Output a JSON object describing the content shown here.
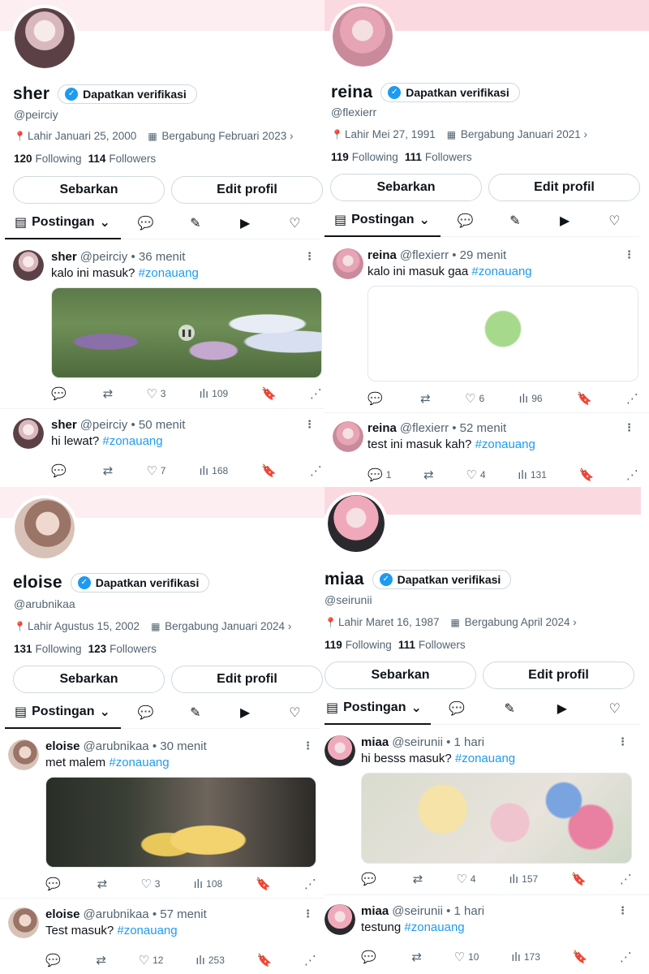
{
  "colors": {
    "accent": "#1d9bf0",
    "banner_pink": "#fbd9e0",
    "banner_light": "#fdeef2"
  },
  "icons": {
    "location": "📍",
    "calendar": "▦",
    "chevron": "›",
    "posts_tab": "▤",
    "chevron_down": "⌄",
    "reply": "💬",
    "highlights": "✎",
    "media": "▶",
    "like": "♡",
    "retweet": "⇄",
    "views": "ılı",
    "bookmark": "🔖",
    "share": "⋰",
    "more": "⋮"
  },
  "profiles": [
    {
      "name": "sher",
      "verify_label": "Dapatkan verifikasi",
      "handle": "@peirciy",
      "birth": "Lahir Januari 25, 2000",
      "joined": "Bergabung Februari 2023",
      "following": "120",
      "following_label": "Following",
      "followers": "114",
      "followers_label": "Followers",
      "share_btn": "Sebarkan",
      "edit_btn": "Edit profil",
      "tab_label": "Postingan",
      "posts": [
        {
          "name": "sher",
          "handle": "@peirciy",
          "time": "• 36 menit",
          "text": "kalo ini masuk?",
          "hashtag": "#zonauang",
          "replies": "",
          "likes": "3",
          "views": "109"
        },
        {
          "name": "sher",
          "handle": "@peirciy",
          "time": "• 50 menit",
          "text": "hi lewat?",
          "hashtag": "#zonauang",
          "replies": "",
          "likes": "7",
          "views": "168"
        }
      ]
    },
    {
      "name": "reina",
      "verify_label": "Dapatkan verifikasi",
      "handle": "@flexierr",
      "birth": "Lahir Mei 27, 1991",
      "joined": "Bergabung Januari 2021",
      "following": "119",
      "following_label": "Following",
      "followers": "111",
      "followers_label": "Followers",
      "share_btn": "Sebarkan",
      "edit_btn": "Edit profil",
      "tab_label": "Postingan",
      "posts": [
        {
          "name": "reina",
          "handle": "@flexierr",
          "time": "• 29 menit",
          "text": "kalo ini masuk gaa",
          "hashtag": "#zonauang",
          "replies": "",
          "likes": "6",
          "views": "96"
        },
        {
          "name": "reina",
          "handle": "@flexierr",
          "time": "• 52 menit",
          "text": "test ini masuk kah?",
          "hashtag": "#zonauang",
          "replies": "1",
          "likes": "4",
          "views": "131"
        }
      ]
    },
    {
      "name": "eloise",
      "verify_label": "Dapatkan verifikasi",
      "handle": "@arubnikaa",
      "birth": "Lahir Agustus 15, 2002",
      "joined": "Bergabung Januari 2024",
      "following": "131",
      "following_label": "Following",
      "followers": "123",
      "followers_label": "Followers",
      "share_btn": "Sebarkan",
      "edit_btn": "Edit profil",
      "tab_label": "Postingan",
      "posts": [
        {
          "name": "eloise",
          "handle": "@arubnikaa",
          "time": "• 30 menit",
          "text": "met malem",
          "hashtag": "#zonauang",
          "replies": "",
          "likes": "3",
          "views": "108"
        },
        {
          "name": "eloise",
          "handle": "@arubnikaa",
          "time": "• 57 menit",
          "text": "Test masuk?",
          "hashtag": "#zonauang",
          "replies": "",
          "likes": "12",
          "views": "253"
        }
      ]
    },
    {
      "name": "miaa",
      "verify_label": "Dapatkan verifikasi",
      "handle": "@seirunii",
      "birth": "Lahir Maret 16, 1987",
      "joined": "Bergabung April 2024",
      "following": "119",
      "following_label": "Following",
      "followers": "111",
      "followers_label": "Followers",
      "share_btn": "Sebarkan",
      "edit_btn": "Edit profil",
      "tab_label": "Postingan",
      "posts": [
        {
          "name": "miaa",
          "handle": "@seirunii",
          "time": "• 1 hari",
          "text": "hi besss masuk?",
          "hashtag": "#zonauang",
          "replies": "",
          "likes": "4",
          "views": "157"
        },
        {
          "name": "miaa",
          "handle": "@seirunii",
          "time": "• 1 hari",
          "text": "testung",
          "hashtag": "#zonauang",
          "replies": "",
          "likes": "10",
          "views": "173"
        }
      ]
    }
  ]
}
